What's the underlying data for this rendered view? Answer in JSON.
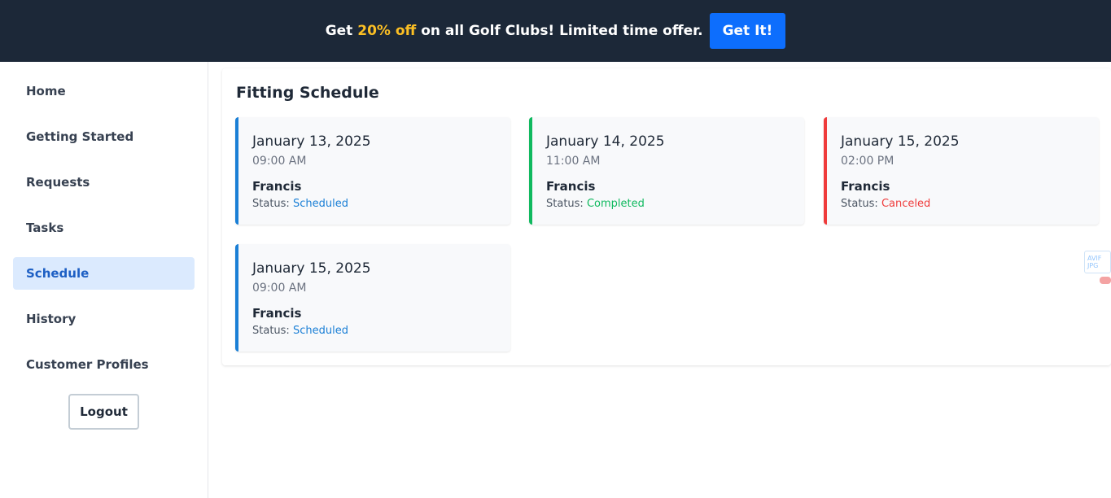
{
  "banner": {
    "text_before": "Get",
    "highlight": "20% off",
    "text_after": "on all Golf Clubs! Limited time offer.",
    "cta_label": "Get It!"
  },
  "sidebar": {
    "items": [
      {
        "label": "Home"
      },
      {
        "label": "Getting Started"
      },
      {
        "label": "Requests"
      },
      {
        "label": "Tasks"
      },
      {
        "label": "Schedule",
        "active": true
      },
      {
        "label": "History"
      },
      {
        "label": "Customer Profiles"
      }
    ],
    "logout_label": "Logout"
  },
  "main": {
    "title": "Fitting Schedule",
    "status_prefix": "Status:",
    "appointments": [
      {
        "date": "January 13, 2025",
        "time": "09:00 AM",
        "name": "Francis",
        "status": "Scheduled"
      },
      {
        "date": "January 14, 2025",
        "time": "11:00 AM",
        "name": "Francis",
        "status": "Completed"
      },
      {
        "date": "January 15, 2025",
        "time": "02:00 PM",
        "name": "Francis",
        "status": "Canceled"
      },
      {
        "date": "January 15, 2025",
        "time": "09:00 AM",
        "name": "Francis",
        "status": "Scheduled"
      }
    ]
  },
  "extension_badge": {
    "line1": "AVIF",
    "line2": "JPG"
  },
  "colors": {
    "banner_bg": "#1c2838",
    "highlight": "#fbbf24",
    "accent": "#0d6efd",
    "scheduled": "#1a7fd6",
    "completed": "#10b95f",
    "canceled": "#ef3b3b",
    "active_nav_bg": "#dbeafe"
  }
}
